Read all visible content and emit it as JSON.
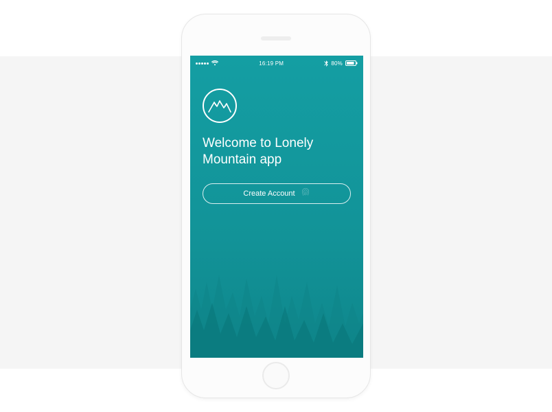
{
  "status_bar": {
    "time": "16:19 PM",
    "battery_pct": "80%"
  },
  "welcome": {
    "title": "Welcome to Lonely Mountain app"
  },
  "cta": {
    "label": "Create Account"
  }
}
